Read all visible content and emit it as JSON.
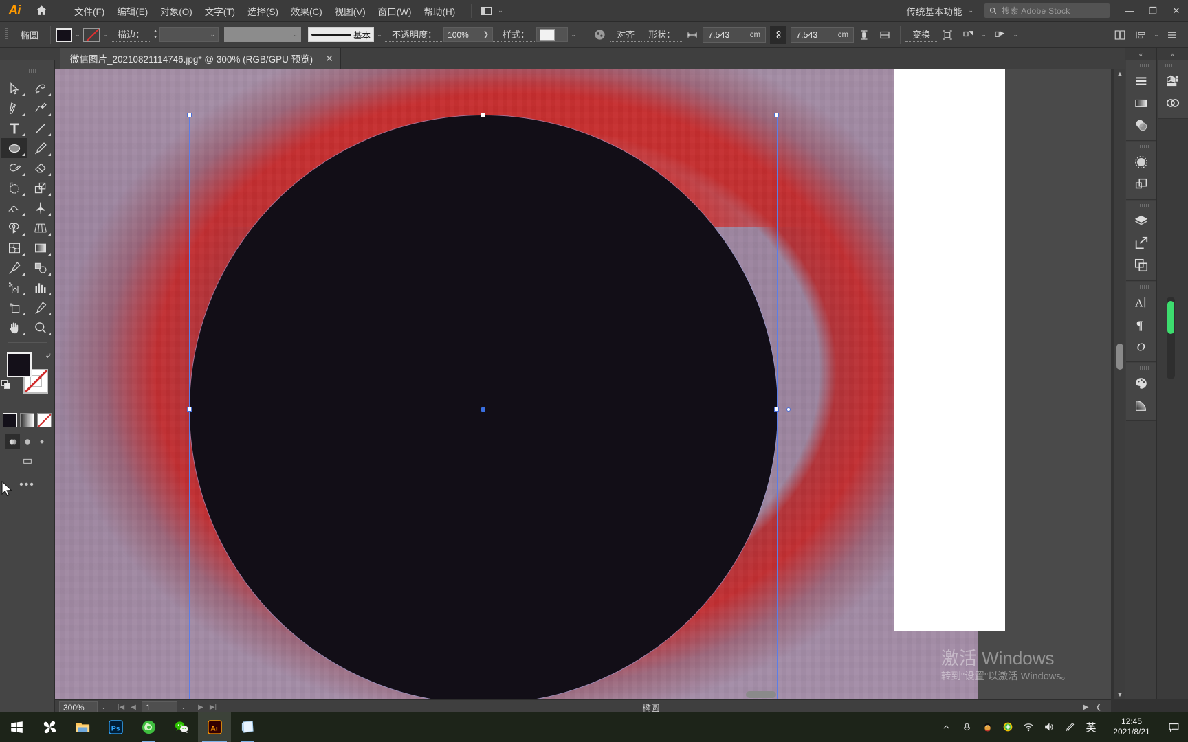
{
  "app": {
    "name": "Adobe Illustrator",
    "logo_text": "Ai"
  },
  "menubar": {
    "home_icon": "home-icon",
    "items": [
      {
        "label": "文件(F)",
        "name": "menu-file"
      },
      {
        "label": "编辑(E)",
        "name": "menu-edit"
      },
      {
        "label": "对象(O)",
        "name": "menu-object"
      },
      {
        "label": "文字(T)",
        "name": "menu-type"
      },
      {
        "label": "选择(S)",
        "name": "menu-select"
      },
      {
        "label": "效果(C)",
        "name": "menu-effect"
      },
      {
        "label": "视图(V)",
        "name": "menu-view"
      },
      {
        "label": "窗口(W)",
        "name": "menu-window"
      },
      {
        "label": "帮助(H)",
        "name": "menu-help"
      }
    ],
    "arrange_caret": "⌄",
    "workspace": "传统基本功能",
    "workspace_caret": "⌄",
    "search_placeholder": "搜索 Adobe Stock",
    "window_minimize": "—",
    "window_restore": "❐",
    "window_close": "✕"
  },
  "controlbar": {
    "object_label": "椭圆",
    "fill_color": "#141019",
    "stroke_none_label": "无",
    "stroke_label": "描边：",
    "stroke_weight": "",
    "stroke_profile": "",
    "brush_label": "基本",
    "opacity_label": "不透明度：",
    "opacity_value": "100%",
    "opacity_arrow": "❯",
    "style_label": "样式：",
    "align_label": "对齐",
    "shape_label": "形状：",
    "width_value": "7.543",
    "width_unit": "cm",
    "height_value": "7.543",
    "height_unit": "cm",
    "link_icon": "link-chain-icon",
    "transform_label": "变换",
    "caret": "⌄"
  },
  "tabbar": {
    "document_title": "微信图片_20210821114746.jpg* @ 300% (RGB/GPU 预览)",
    "close_label": "✕"
  },
  "toolbar": {
    "tools": [
      {
        "name": "selection-tool",
        "icon": "arrow-cursor-icon",
        "active": false
      },
      {
        "name": "direct-selection-tool",
        "icon": "magic-wand-icon",
        "active": false
      },
      {
        "name": "pen-tool",
        "icon": "pen-icon",
        "active": false
      },
      {
        "name": "curvature-tool",
        "icon": "curvature-icon",
        "active": false
      },
      {
        "name": "type-tool",
        "icon": "type-T-icon",
        "active": false
      },
      {
        "name": "line-segment-tool",
        "icon": "line-icon",
        "active": false
      },
      {
        "name": "ellipse-tool",
        "icon": "ellipse-icon",
        "active": true
      },
      {
        "name": "paintbrush-tool",
        "icon": "paintbrush-icon",
        "active": false
      },
      {
        "name": "shaper-tool",
        "icon": "shaper-icon",
        "active": false
      },
      {
        "name": "eraser-tool",
        "icon": "eraser-icon",
        "active": false
      },
      {
        "name": "rotate-tool",
        "icon": "rotate-icon",
        "active": false
      },
      {
        "name": "scale-tool",
        "icon": "scale-icon",
        "active": false
      },
      {
        "name": "width-tool",
        "icon": "width-warp-icon",
        "active": false
      },
      {
        "name": "free-transform-tool",
        "icon": "pushpin-icon",
        "active": false
      },
      {
        "name": "shape-builder-tool",
        "icon": "shape-builder-icon",
        "active": false
      },
      {
        "name": "perspective-grid-tool",
        "icon": "perspective-grid-icon",
        "active": false
      },
      {
        "name": "mesh-tool",
        "icon": "mesh-icon",
        "active": false
      },
      {
        "name": "gradient-tool",
        "icon": "gradient-icon",
        "active": false
      },
      {
        "name": "eyedropper-tool",
        "icon": "eyedropper-icon",
        "active": false
      },
      {
        "name": "blend-tool",
        "icon": "blend-icon",
        "active": false
      },
      {
        "name": "symbol-sprayer-tool",
        "icon": "symbol-sprayer-icon",
        "active": false
      },
      {
        "name": "column-graph-tool",
        "icon": "bar-chart-icon",
        "active": false
      },
      {
        "name": "artboard-tool",
        "icon": "artboard-icon",
        "active": false
      },
      {
        "name": "slice-tool",
        "icon": "knife-icon",
        "active": false
      },
      {
        "name": "hand-tool",
        "icon": "hand-icon",
        "active": false
      },
      {
        "name": "zoom-tool",
        "icon": "magnifier-icon",
        "active": false
      }
    ],
    "fill_color": "#141019",
    "stroke_color": "#ffffff",
    "swap_icon": "swap-arrow-icon",
    "default_colors_icon": "default-fill-stroke-icon",
    "color_modes": [
      {
        "name": "color-mode-solid",
        "icon": "solid-color-icon"
      },
      {
        "name": "color-mode-gradient",
        "icon": "gradient-swatch-icon"
      },
      {
        "name": "color-mode-none",
        "icon": "none-swatch-icon"
      }
    ],
    "screen_modes": [
      {
        "name": "screen-mode-normal",
        "icon": "screen-normal-icon"
      },
      {
        "name": "screen-mode-fullmenu",
        "icon": "screen-full-menu-icon"
      },
      {
        "name": "screen-mode-full",
        "icon": "screen-full-icon"
      }
    ],
    "dock_toggle_icon": "dock-toggle-icon",
    "more_tools": "•••"
  },
  "canvas": {
    "zoom": "300%",
    "ellipse_fill": "#120e17",
    "selection_color": "#5b7ee8",
    "background_color": "#9b849e",
    "accent_red": "#c42a2c",
    "artboard_color": "#ffffff"
  },
  "watermark": {
    "line1": "激活 Windows",
    "line2": "转到\"设置\"以激活 Windows。"
  },
  "statusbar": {
    "zoom": "300%",
    "zoom_caret": "⌄",
    "nav_first": "|◀",
    "nav_prev": "◀",
    "page": "1",
    "page_caret": "⌄",
    "nav_next": "▶",
    "nav_last": "▶|",
    "current_tool": "椭圆",
    "right_arrow": "▶",
    "left_arrow": "❮"
  },
  "right_panel": {
    "collapse_icon": "double-chevron-left-icon",
    "column_one": [
      {
        "name": "panel-properties",
        "icon": "properties-lines-icon"
      },
      {
        "name": "panel-gradient",
        "icon": "gradient-panel-icon"
      },
      {
        "name": "panel-transparency",
        "icon": "transparency-circles-icon"
      },
      {
        "name": "panel-brushes",
        "icon": "brushes-dotted-circle-icon"
      },
      {
        "name": "panel-symbols",
        "icon": "symbols-squares-icon"
      },
      {
        "name": "panel-layers",
        "icon": "layers-stack-icon"
      },
      {
        "name": "panel-asset-export",
        "icon": "asset-export-arrow-icon"
      },
      {
        "name": "panel-artboards",
        "icon": "artboards-icon"
      },
      {
        "name": "panel-character",
        "icon": "character-A-icon"
      },
      {
        "name": "panel-paragraph",
        "icon": "paragraph-pilcrow-icon"
      },
      {
        "name": "panel-glyphs",
        "icon": "glyphs-O-icon"
      },
      {
        "name": "panel-swatches",
        "icon": "palette-icon"
      },
      {
        "name": "panel-gradient-mesh",
        "icon": "quarter-gradient-icon"
      }
    ],
    "column_two": [
      {
        "name": "panel-libraries",
        "icon": "libraries-cube-icon"
      },
      {
        "name": "panel-creative-cloud",
        "icon": "creative-cloud-icon"
      }
    ]
  },
  "taskbar": {
    "items": [
      {
        "name": "taskbar-start",
        "icon": "windows-logo-icon",
        "label": "开始"
      },
      {
        "name": "taskbar-sogou",
        "icon": "sogou-icon",
        "label": "搜狗"
      },
      {
        "name": "taskbar-file-explorer",
        "icon": "folder-icon",
        "label": "文件资源管理器"
      },
      {
        "name": "taskbar-photoshop",
        "icon": "photoshop-icon",
        "label": "Ps"
      },
      {
        "name": "taskbar-browser",
        "icon": "green-browser-icon",
        "label": "浏览器"
      },
      {
        "name": "taskbar-wechat",
        "icon": "wechat-icon",
        "label": "微信"
      },
      {
        "name": "taskbar-illustrator",
        "icon": "illustrator-icon",
        "label": "Ai"
      },
      {
        "name": "taskbar-notepad",
        "icon": "notepad-icon",
        "label": "便笺"
      }
    ],
    "tray": [
      {
        "name": "tray-show-hidden",
        "icon": "chevron-up-icon"
      },
      {
        "name": "tray-microphone",
        "icon": "microphone-icon"
      },
      {
        "name": "tray-qq",
        "icon": "qq-penguin-icon"
      },
      {
        "name": "tray-security",
        "icon": "green-shield-icon"
      },
      {
        "name": "tray-network",
        "icon": "wifi-icon"
      },
      {
        "name": "tray-volume",
        "icon": "speaker-icon"
      },
      {
        "name": "tray-sogou-pen",
        "icon": "pen-tool-tray-icon"
      }
    ],
    "ime": "英",
    "time": "12:45",
    "date": "2021/8/21",
    "notification_icon": "notification-bubble-icon"
  }
}
